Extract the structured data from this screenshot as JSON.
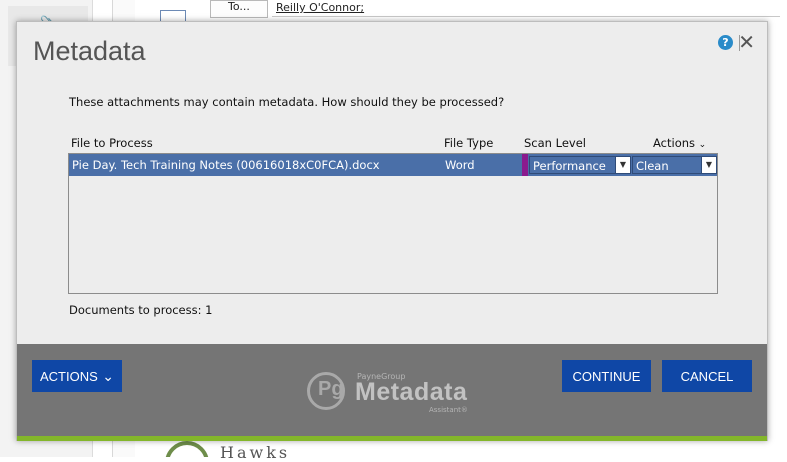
{
  "background": {
    "to_button": "To...",
    "to_recipient": "Reilly O'Connor;",
    "logo_text": "Hawks"
  },
  "dialog": {
    "title": "Metadata",
    "help_icon": "?",
    "close_icon": "✕",
    "prompt": "These attachments may contain metadata. How should they be processed?",
    "columns": {
      "file": "File to Process",
      "type": "File Type",
      "scan": "Scan Level",
      "actions": "Actions"
    },
    "rows": [
      {
        "file": "Pie Day. Tech Training Notes (00616018xC0FCA).docx",
        "type": "Word",
        "scan_level": "Performance",
        "action": "Clean"
      }
    ],
    "docs_label": "Documents to process: 1",
    "footer": {
      "actions_button": "ACTIONS",
      "continue_button": "CONTINUE",
      "cancel_button": "CANCEL",
      "logo_top": "PayneGroup",
      "logo_main": "Metadata",
      "logo_sub": "Assistant®"
    },
    "colors": {
      "selected_row": "#4a6fa8",
      "button": "#0f47a6",
      "footer": "#757575",
      "accent_stripe": "#83b62a",
      "scan_marker": "#8a1a8e"
    }
  }
}
